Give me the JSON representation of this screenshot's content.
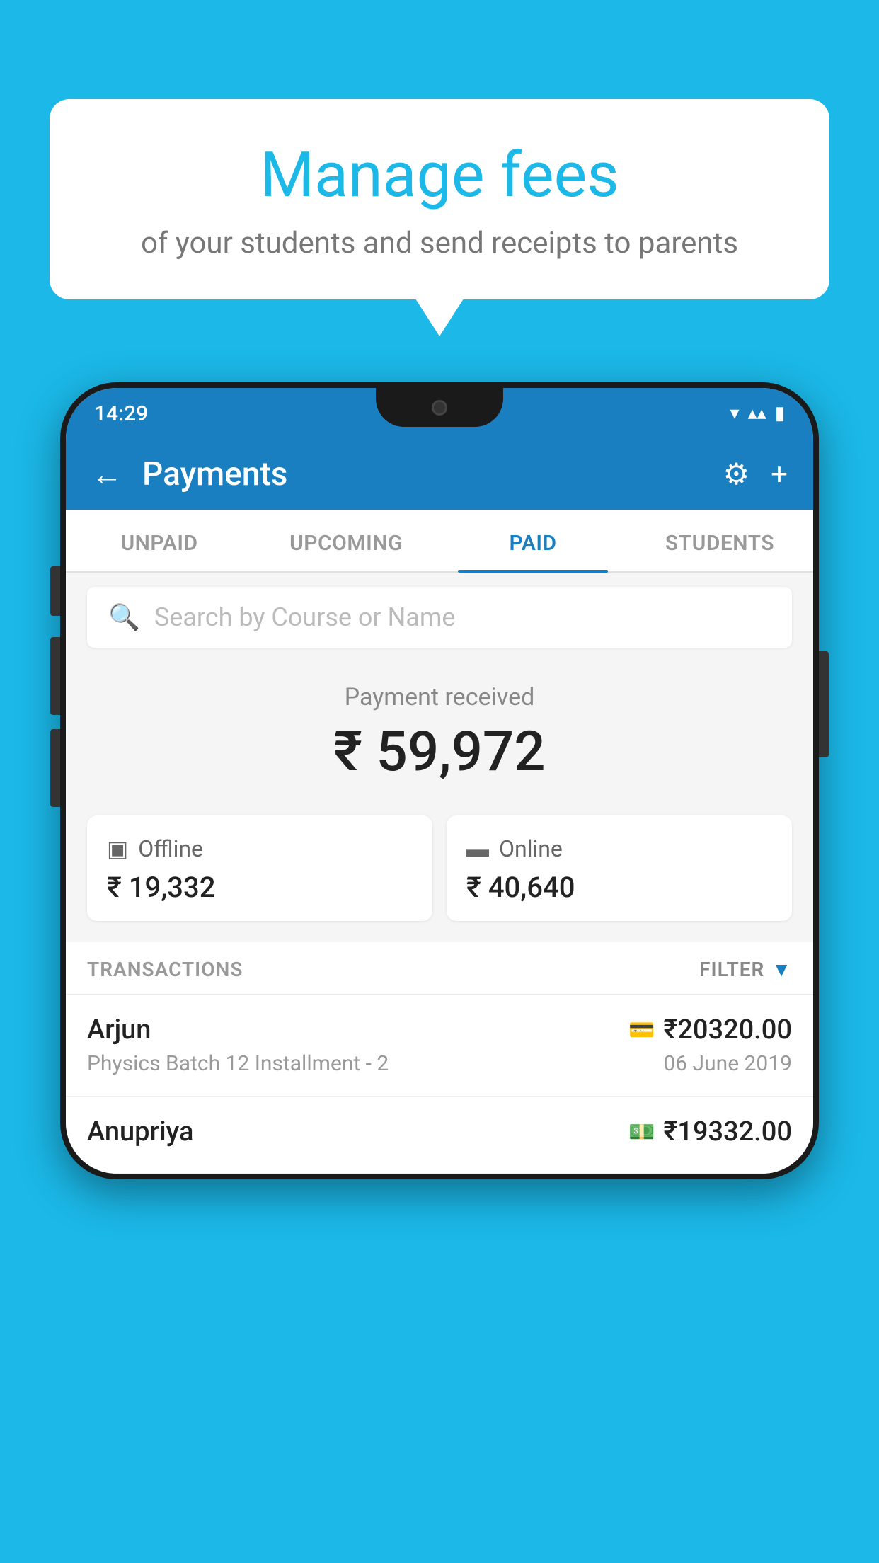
{
  "background_color": "#1bb8e8",
  "speech_bubble": {
    "title": "Manage fees",
    "subtitle": "of your students and send receipts to parents"
  },
  "phone": {
    "status_bar": {
      "time": "14:29",
      "icons": [
        "▼",
        "▲",
        "▮"
      ]
    },
    "header": {
      "back_icon": "←",
      "title": "Payments",
      "settings_icon": "⚙",
      "add_icon": "+"
    },
    "tabs": [
      {
        "label": "UNPAID",
        "active": false
      },
      {
        "label": "UPCOMING",
        "active": false
      },
      {
        "label": "PAID",
        "active": true
      },
      {
        "label": "STUDENTS",
        "active": false
      }
    ],
    "search": {
      "placeholder": "Search by Course or Name",
      "search_icon": "🔍"
    },
    "payment_summary": {
      "label": "Payment received",
      "amount": "₹ 59,972",
      "offline": {
        "type": "Offline",
        "amount": "₹ 19,332"
      },
      "online": {
        "type": "Online",
        "amount": "₹ 40,640"
      }
    },
    "transactions": {
      "label": "TRANSACTIONS",
      "filter_label": "FILTER",
      "items": [
        {
          "name": "Arjun",
          "course": "Physics Batch 12 Installment - 2",
          "amount": "₹20320.00",
          "date": "06 June 2019",
          "payment_icon": "💳"
        },
        {
          "name": "Anupriya",
          "course": "",
          "amount": "₹19332.00",
          "date": "",
          "payment_icon": "💵"
        }
      ]
    }
  }
}
